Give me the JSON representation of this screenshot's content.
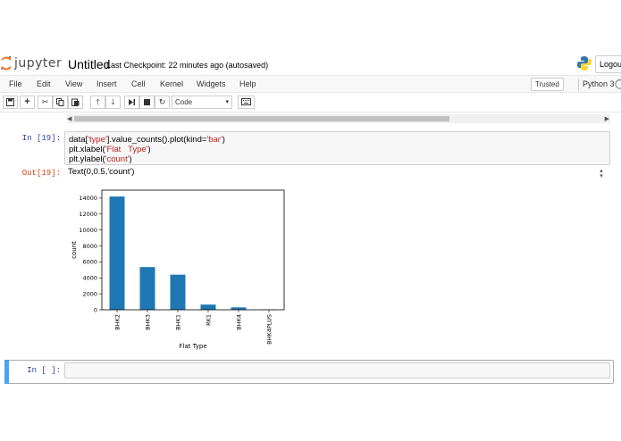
{
  "header": {
    "logo_text": "jupyter",
    "notebook_title": "Untitled",
    "checkpoint": "Last Checkpoint: 22 minutes ago (autosaved)",
    "logout_label": "Logout"
  },
  "menubar": {
    "items": [
      "File",
      "Edit",
      "View",
      "Insert",
      "Cell",
      "Kernel",
      "Widgets",
      "Help"
    ],
    "trusted_label": "Trusted",
    "kernel_name": "Python 3",
    "kernel_indicator": "◯"
  },
  "toolbar": {
    "save_icon": "save-icon",
    "celltype_value": "Code",
    "celltype_arrow": "▾"
  },
  "cells": {
    "in_prompt": "In [19]:",
    "out_prompt": "Out[19]:",
    "code_l1_a": "data[",
    "code_l1_s": "'type'",
    "code_l1_b": "].value_counts().plot(kind=",
    "code_l1_s2": "'bar'",
    "code_l1_c": ")",
    "code_l2_a": "plt.xlabel(",
    "code_l2_s": "'Flat   Type'",
    "code_l2_b": ")",
    "code_l3_a": "plt.ylabel(",
    "code_l3_s": "'count'",
    "code_l3_b": ")",
    "output_text": "Text(0,0.5,'count')",
    "empty_prompt": "In  [  ]:"
  },
  "chart_data": {
    "type": "bar",
    "categories": [
      "BHK2",
      "BHK3",
      "BHK1",
      "RK1",
      "BHK4",
      "BHK4PLUS"
    ],
    "values": [
      14200,
      5350,
      4400,
      650,
      300,
      50
    ],
    "xlabel": "Flat Type",
    "ylabel": "count",
    "ylim": [
      0,
      15000
    ],
    "yticks": [
      0,
      2000,
      4000,
      6000,
      8000,
      10000,
      12000,
      14000
    ],
    "color": "#1f77b4",
    "grid": false
  }
}
